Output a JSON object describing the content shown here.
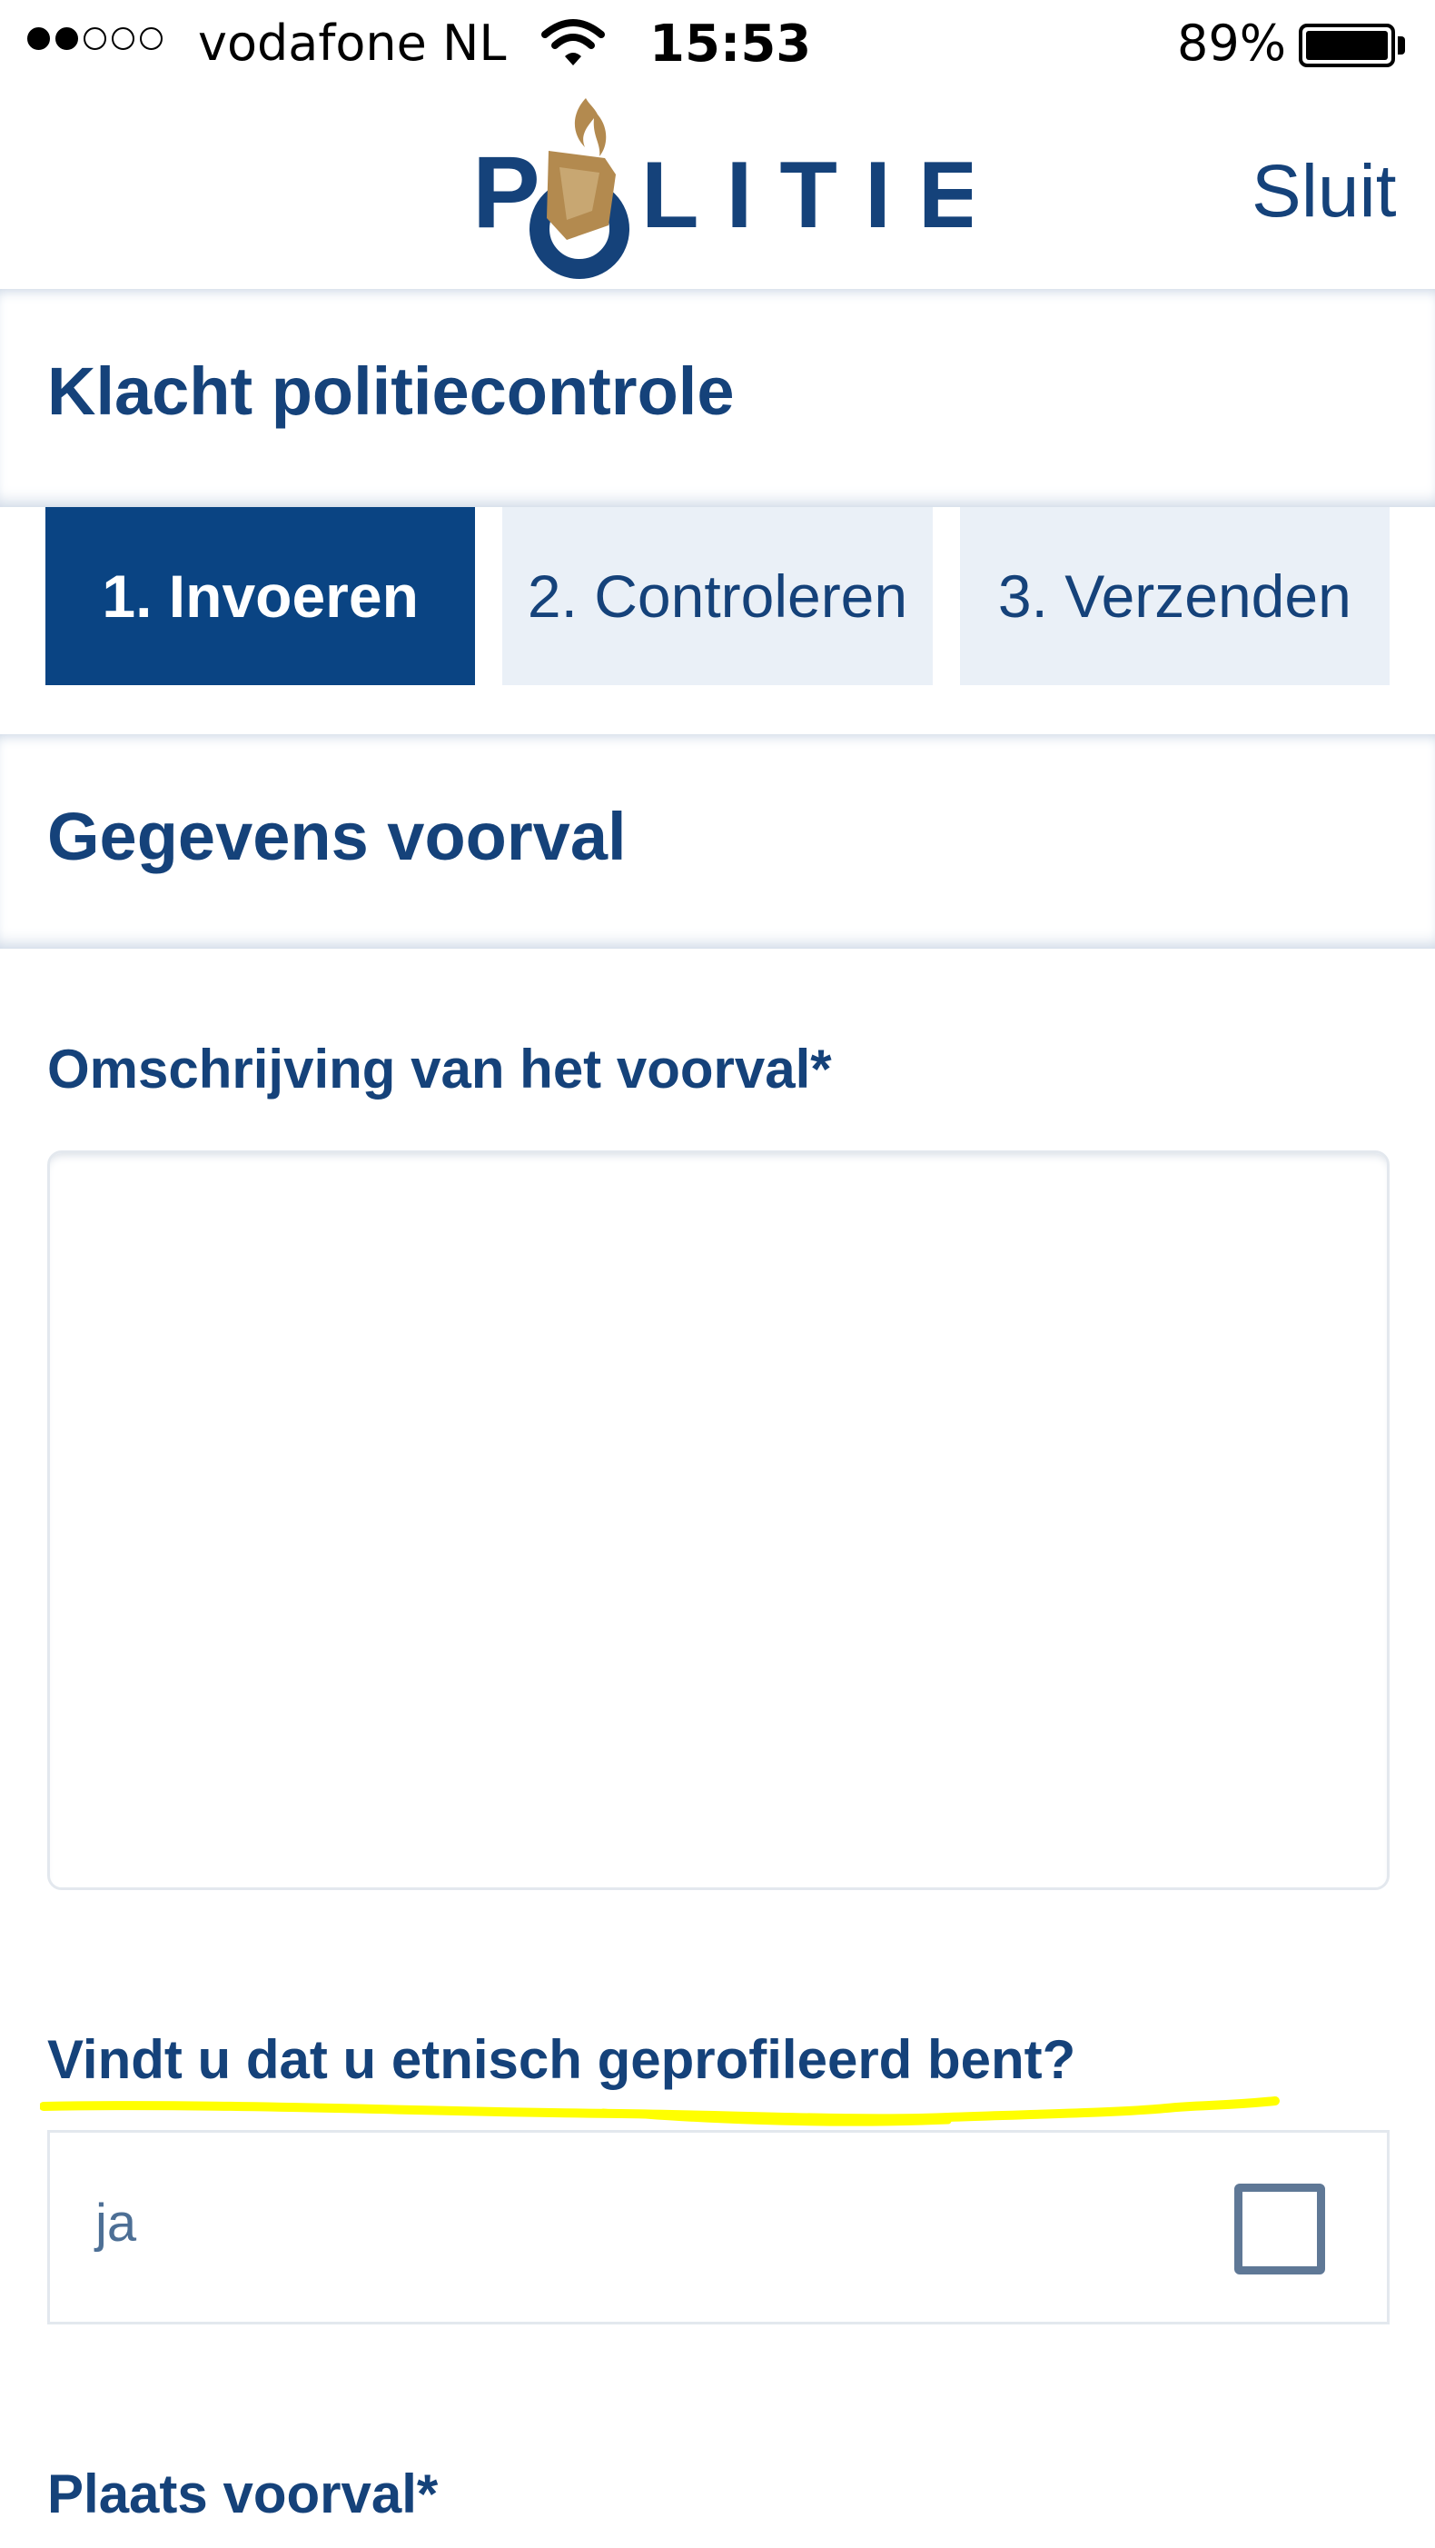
{
  "status_bar": {
    "carrier": "vodafone NL",
    "signal_bars_filled": 2,
    "signal_bars_total": 5,
    "time": "15:53",
    "battery_percent": "89%",
    "battery_level": 0.89
  },
  "header": {
    "logo_text": "POLITIE",
    "close_label": "Sluit"
  },
  "page": {
    "title": "Klacht politiecontrole"
  },
  "steps": [
    {
      "label": "1. Invoeren",
      "active": true
    },
    {
      "label": "2. Controleren",
      "active": false
    },
    {
      "label": "3. Verzenden",
      "active": false
    }
  ],
  "section": {
    "title": "Gegevens voorval"
  },
  "form": {
    "description_label": "Omschrijving van het voorval*",
    "description_value": "",
    "profiling_label": "Vindt u dat u etnisch geprofileerd bent?",
    "profiling_option": "ja",
    "profiling_checked": false,
    "place_label": "Plaats voorval*"
  },
  "colors": {
    "brand_blue": "#15427a",
    "active_step": "#0a4483",
    "inactive_step": "#eaf0f7",
    "logo_gold": "#b38a4f",
    "highlight": "#ffff00"
  }
}
